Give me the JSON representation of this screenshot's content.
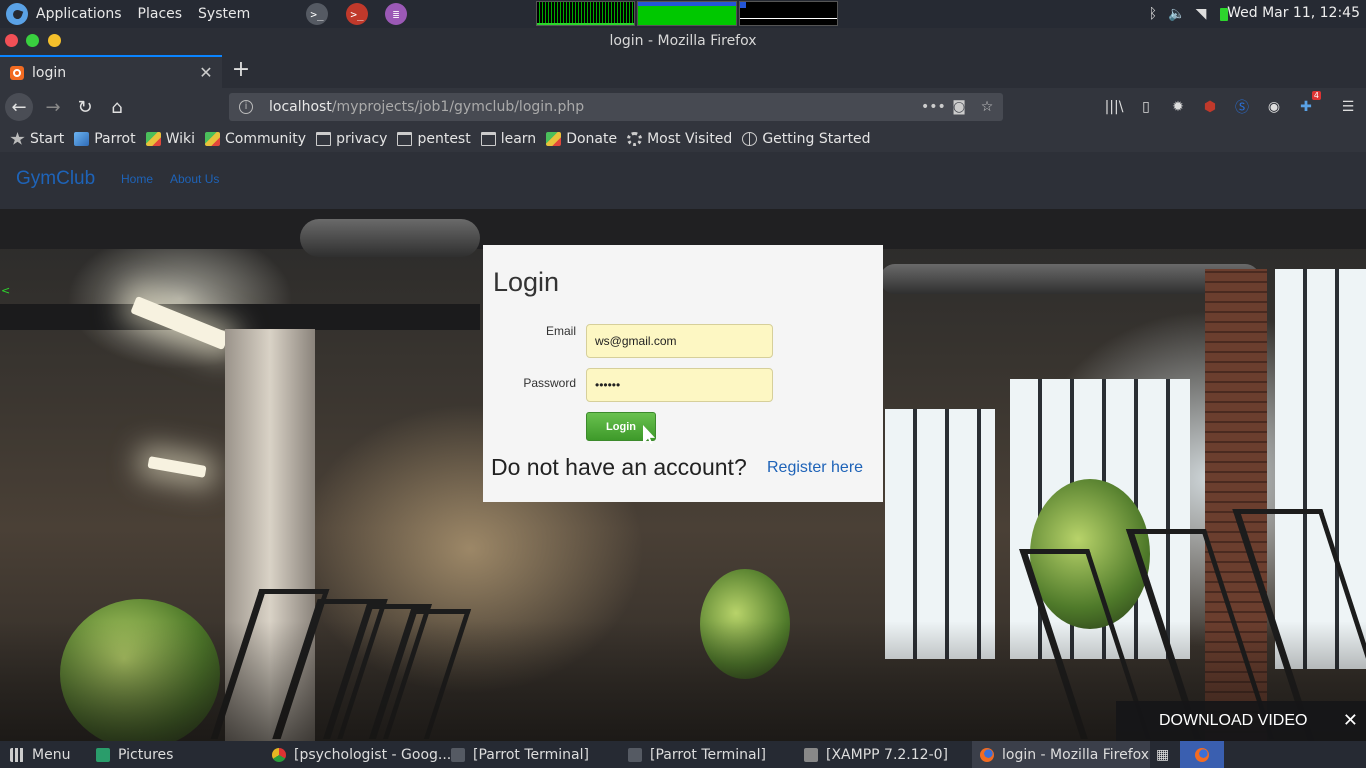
{
  "system_panel": {
    "menus": [
      "Applications",
      "Places",
      "System"
    ],
    "clock": "Wed Mar 11, 12:45"
  },
  "window": {
    "title": "login - Mozilla Firefox"
  },
  "tab": {
    "label": "login"
  },
  "urlbar": {
    "host": "localhost",
    "path": "/myprojects/job1/gymclub/login.php"
  },
  "toolbar": {
    "addon_badge": "4"
  },
  "bookmarks": [
    "Start",
    "Parrot",
    "Wiki",
    "Community",
    "privacy",
    "pentest",
    "learn",
    "Donate",
    "Most Visited",
    "Getting Started"
  ],
  "site": {
    "brand": "GymClub",
    "nav": [
      "Home",
      "About Us"
    ]
  },
  "login": {
    "heading": "Login",
    "email_label": "Email",
    "email_value": "ws@gmail.com",
    "password_label": "Password",
    "password_value": "••••••",
    "button": "Login",
    "no_account": "Do not have an account?",
    "register": "Register here"
  },
  "download_bar": {
    "label": "DOWNLOAD VIDEO",
    "close": "✕"
  },
  "taskbar": {
    "menu": "Menu",
    "pictures": "Pictures",
    "tasks": [
      "[psychologist - Goog...",
      "[Parrot Terminal]",
      "[Parrot Terminal]",
      "[XAMPP 7.2.12-0]",
      "login - Mozilla Firefox"
    ]
  },
  "colors": {
    "accent": "#0a84ff",
    "link": "#1e63b8",
    "login_button": "#4fab38",
    "autofill": "#fdf7c3"
  }
}
